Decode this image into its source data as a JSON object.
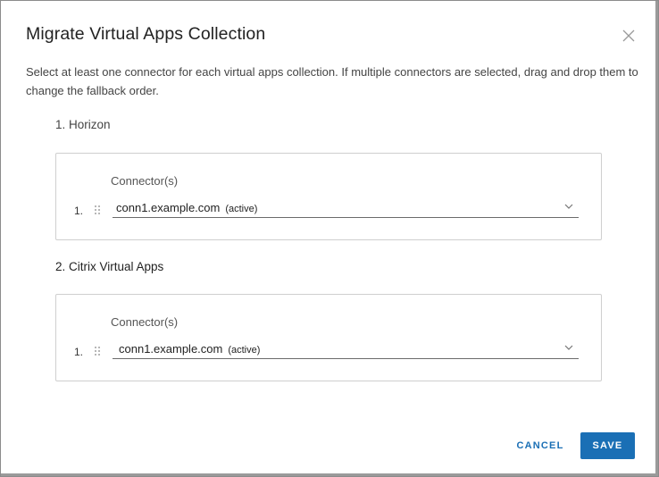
{
  "dialog": {
    "title": "Migrate Virtual Apps Collection",
    "description": "Select at least one connector for each virtual apps collection. If multiple connectors are selected, drag and drop them to change the fallback order."
  },
  "collections": [
    {
      "title": "1. Horizon",
      "connector_label": "Connector(s)",
      "rows": [
        {
          "index": "1.",
          "connector": "conn1.example.com",
          "status": "(active)"
        }
      ]
    },
    {
      "title": "2.  Citrix Virtual Apps",
      "connector_label": "Connector(s)",
      "rows": [
        {
          "index": "1.",
          "connector": "conn1.example.com",
          "status": "(active)"
        }
      ]
    }
  ],
  "footer": {
    "cancel_label": "CANCEL",
    "save_label": "SAVE"
  },
  "colors": {
    "accent": "#1a6fb5",
    "border": "#cfcfcf"
  },
  "icons": {
    "close": "close-icon",
    "drag": "drag-handle-icon",
    "dropdown": "chevron-down-icon"
  }
}
